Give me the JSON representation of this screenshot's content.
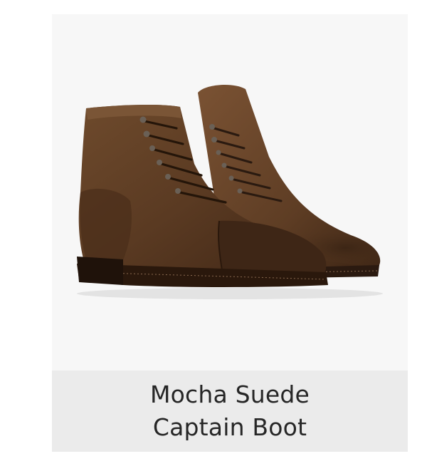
{
  "product": {
    "image_alt": "Mocha Suede Captain Boot",
    "title_line1": "Mocha Suede",
    "title_line2": "Captain Boot"
  },
  "colors": {
    "card_background": "#f7f7f7",
    "caption_background": "#ebebeb",
    "title_text": "#262626",
    "suede_brown": "#5a3a22"
  }
}
